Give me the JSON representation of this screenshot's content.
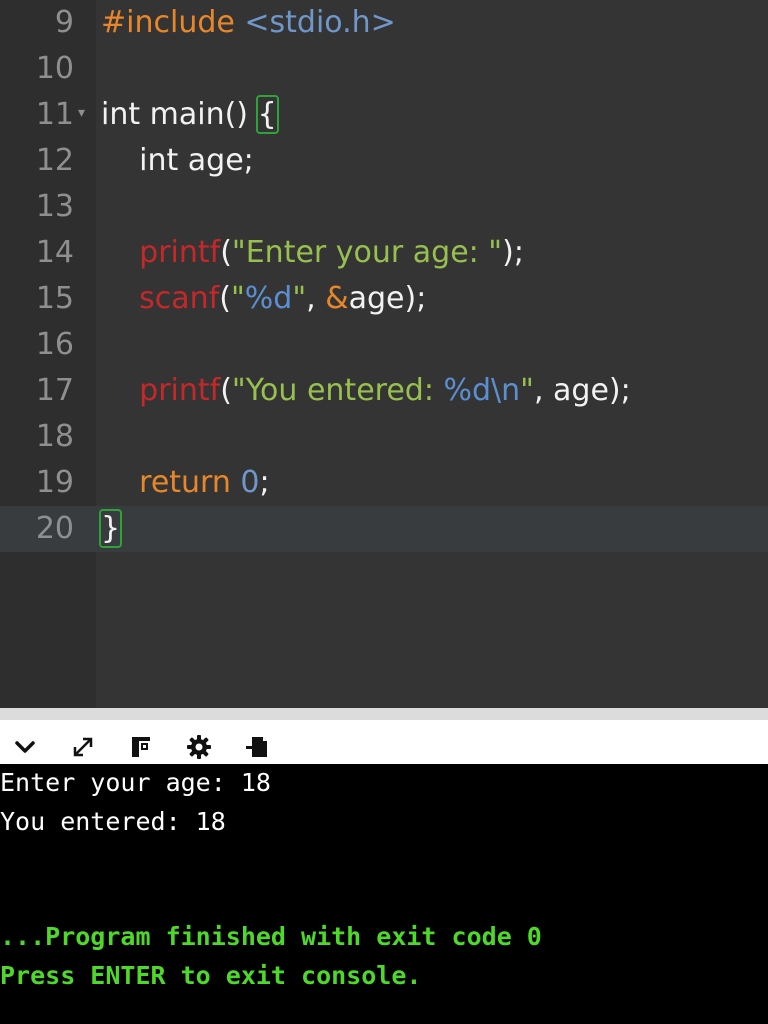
{
  "editor": {
    "lines": [
      {
        "number": "9",
        "fold": "",
        "tokens": [
          {
            "text": "#include ",
            "kind": "preproc"
          },
          {
            "text": "<stdio.h>",
            "kind": "header"
          }
        ]
      },
      {
        "number": "10",
        "fold": "",
        "tokens": []
      },
      {
        "number": "11",
        "fold": "▾",
        "tokens": [
          {
            "text": "int main() ",
            "kind": "plain"
          },
          {
            "text": "{",
            "kind": "plain",
            "match": true
          }
        ]
      },
      {
        "number": "12",
        "fold": "",
        "tokens": [
          {
            "text": "    int age;",
            "kind": "plain"
          }
        ]
      },
      {
        "number": "13",
        "fold": "",
        "tokens": []
      },
      {
        "number": "14",
        "fold": "",
        "tokens": [
          {
            "text": "    printf",
            "kind": "func"
          },
          {
            "text": "(",
            "kind": "plain"
          },
          {
            "text": "\"Enter your age: \"",
            "kind": "string"
          },
          {
            "text": ");",
            "kind": "plain"
          }
        ]
      },
      {
        "number": "15",
        "fold": "",
        "tokens": [
          {
            "text": "    scanf",
            "kind": "func"
          },
          {
            "text": "(",
            "kind": "plain"
          },
          {
            "text": "\"",
            "kind": "string"
          },
          {
            "text": "%d",
            "kind": "escape"
          },
          {
            "text": "\"",
            "kind": "string"
          },
          {
            "text": ", ",
            "kind": "plain"
          },
          {
            "text": "&",
            "kind": "amp"
          },
          {
            "text": "age);",
            "kind": "plain"
          }
        ]
      },
      {
        "number": "16",
        "fold": "",
        "tokens": []
      },
      {
        "number": "17",
        "fold": "",
        "tokens": [
          {
            "text": "    printf",
            "kind": "func"
          },
          {
            "text": "(",
            "kind": "plain"
          },
          {
            "text": "\"You entered: ",
            "kind": "string"
          },
          {
            "text": "%d\\n",
            "kind": "escape"
          },
          {
            "text": "\"",
            "kind": "string"
          },
          {
            "text": ", age);",
            "kind": "plain"
          }
        ]
      },
      {
        "number": "18",
        "fold": "",
        "tokens": []
      },
      {
        "number": "19",
        "fold": "",
        "tokens": [
          {
            "text": "    return ",
            "kind": "keyword"
          },
          {
            "text": "0",
            "kind": "number"
          },
          {
            "text": ";",
            "kind": "plain"
          }
        ]
      },
      {
        "number": "20",
        "fold": "",
        "active": true,
        "tokens": [
          {
            "text": "}",
            "kind": "plain",
            "match": true
          }
        ]
      }
    ]
  },
  "toolbar": {
    "buttons": [
      {
        "name": "collapse-console-button",
        "icon": "chevron-down-icon"
      },
      {
        "name": "maximize-console-button",
        "icon": "expand-icon"
      },
      {
        "name": "copy-output-button",
        "icon": "copy-icon"
      },
      {
        "name": "settings-button",
        "icon": "gear-icon"
      },
      {
        "name": "download-output-button",
        "icon": "download-icon"
      }
    ]
  },
  "console": {
    "lines": [
      {
        "text": "Enter your age: 18",
        "kind": "out"
      },
      {
        "text": "You entered: 18",
        "kind": "out"
      },
      {
        "text": "",
        "kind": "out"
      },
      {
        "text": "",
        "kind": "out"
      },
      {
        "text": "...Program finished with exit code 0",
        "kind": "status"
      },
      {
        "text": "Press ENTER to exit console.",
        "kind": "status"
      }
    ]
  },
  "colors": {
    "editor_bg": "#343434",
    "gutter_bg": "#2e2e2e",
    "preprocessor": "#e8872a",
    "function": "#c6282a",
    "string": "#97c04e",
    "escape": "#5c8fd0",
    "console_bg": "#000000",
    "console_status": "#4ed82a"
  }
}
